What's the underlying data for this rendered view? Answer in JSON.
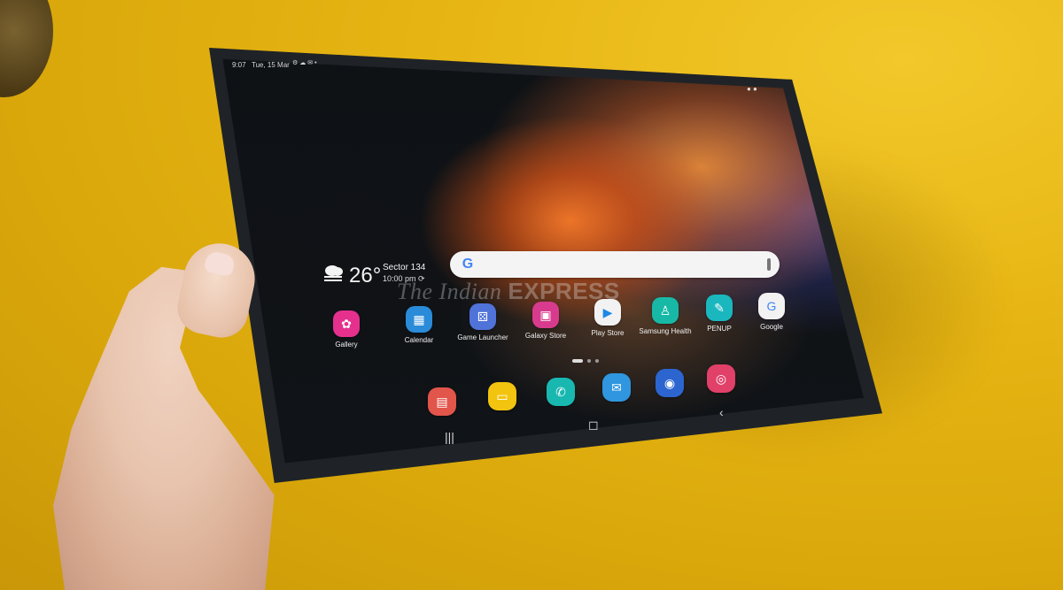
{
  "status_bar": {
    "time": "9:07",
    "date": "Tue, 15 Mar",
    "icons": [
      "gear-icon",
      "cloud-icon",
      "message-icon",
      "dot-icon"
    ],
    "right_indicator": "● ●"
  },
  "weather": {
    "temperature": "26°",
    "location": "Sector 134",
    "time": "10:00 pm"
  },
  "search": {
    "logo_text": "G"
  },
  "watermark": {
    "prefix": "The",
    "middle": "Indian",
    "suffix": "EXPRESS"
  },
  "apps": [
    {
      "label": "Gallery",
      "color": "#e5308e"
    },
    {
      "label": "Calendar",
      "color": "#2a8bd8"
    },
    {
      "label": "Game Launcher",
      "color": "#4f73d9"
    },
    {
      "label": "Galaxy Store",
      "color": "#d83b8d"
    },
    {
      "label": "Play Store",
      "color": "#f2f2f2"
    },
    {
      "label": "Samsung Health",
      "color": "#17b9a6"
    },
    {
      "label": "PENUP",
      "color": "#1ab7bf"
    },
    {
      "label": "Google",
      "color": "#f2f2f2"
    }
  ],
  "dock_apps": [
    {
      "name": "notes-icon",
      "color": "#e2554b"
    },
    {
      "name": "folder-icon",
      "color": "#f2c40f"
    },
    {
      "name": "phone-icon",
      "color": "#18b8b0"
    },
    {
      "name": "messages-icon",
      "color": "#2f96df"
    },
    {
      "name": "internet-icon",
      "color": "#2c65cf"
    },
    {
      "name": "camera-icon",
      "color": "#e14069"
    }
  ],
  "nav": {
    "recent": "|||",
    "home": "◻",
    "back": "‹"
  }
}
